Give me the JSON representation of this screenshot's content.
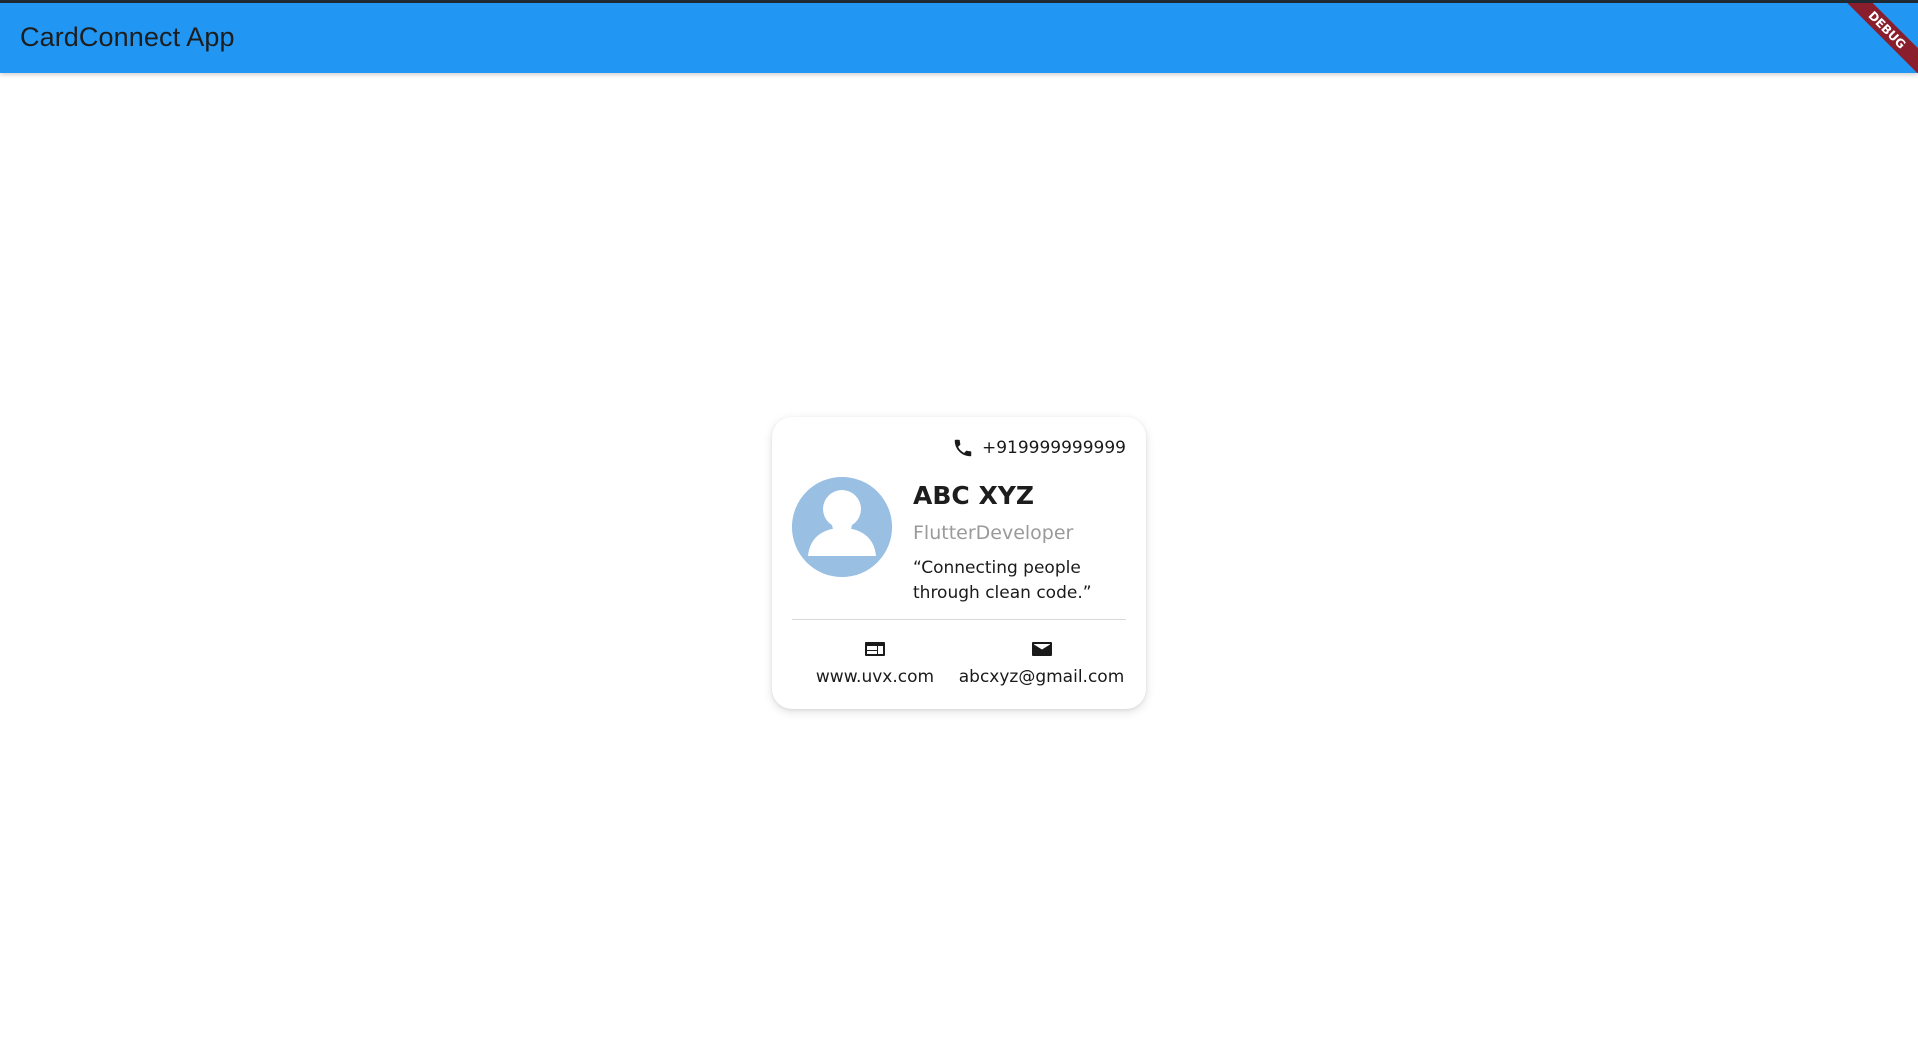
{
  "app": {
    "title": "CardConnect App",
    "debug_banner": "DEBUG",
    "accent_color": "#2196f3"
  },
  "card": {
    "phone": "+919999999999",
    "name": "ABC XYZ",
    "role": "FlutterDeveloper",
    "quote": "“Connecting people through clean code.”",
    "website": "www.uvx.com",
    "email": "abcxyz@gmail.com",
    "icons": {
      "phone": "phone-icon",
      "avatar": "person-avatar-icon",
      "website": "web-icon",
      "email": "mail-icon"
    }
  }
}
